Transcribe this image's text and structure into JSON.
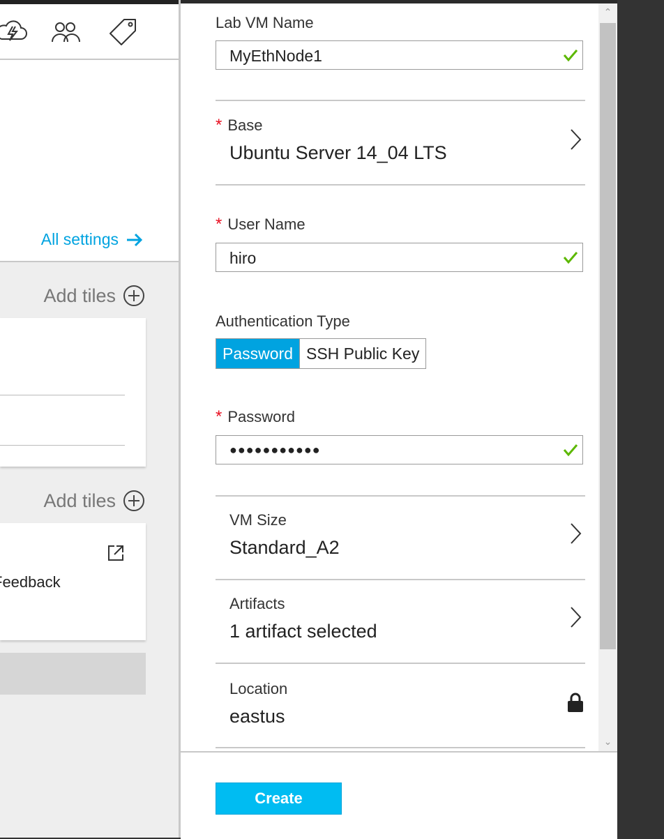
{
  "left_blade": {
    "toolbar_icons": [
      "cloud-lightning-icon",
      "users-icon",
      "tag-icon"
    ],
    "all_settings_label": "All settings",
    "add_tiles_label": "Add tiles",
    "feedback_text": "Feedback"
  },
  "form": {
    "lab_vm_name": {
      "label": "Lab VM Name",
      "value": "MyEthNode1"
    },
    "base": {
      "required_mark": "*",
      "label": "Base",
      "value": "Ubuntu Server 14_04 LTS"
    },
    "user_name": {
      "required_mark": "*",
      "label": "User Name",
      "value": "hiro"
    },
    "authentication_type": {
      "label": "Authentication Type",
      "options": [
        "Password",
        "SSH Public Key"
      ],
      "selected": "Password"
    },
    "password": {
      "required_mark": "*",
      "label": "Password",
      "value": "●●●●●●●●●●●"
    },
    "vm_size": {
      "label": "VM Size",
      "value": "Standard_A2"
    },
    "artifacts": {
      "label": "Artifacts",
      "value": "1 artifact selected"
    },
    "location": {
      "label": "Location",
      "value": "eastus"
    }
  },
  "footer": {
    "create_label": "Create"
  },
  "colors": {
    "accent": "#00a3e0",
    "create_button": "#00bcf2",
    "valid_check": "#5cb800",
    "required_mark": "#e81123"
  }
}
